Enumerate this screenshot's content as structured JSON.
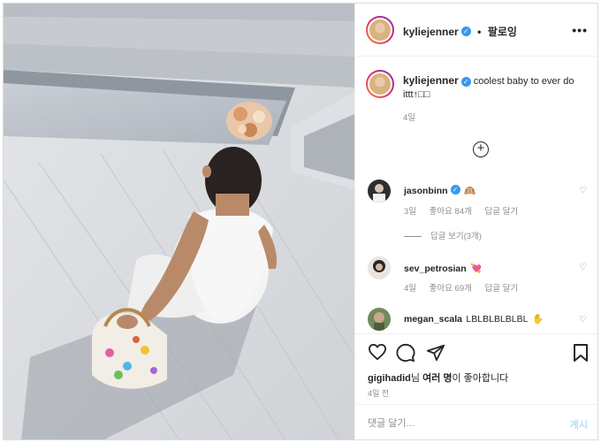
{
  "header": {
    "username": "kyliejenner",
    "separator": "•",
    "follow_label": "팔로잉",
    "more_label": "•••"
  },
  "caption": {
    "username": "kyliejenner",
    "text": "coolest baby to ever do ittt",
    "emoji": "↑□□",
    "age": "4일"
  },
  "comments": [
    {
      "username": "jasonbinn",
      "text": "",
      "emoji": "🙉",
      "age": "3일",
      "likes": "좋아요 84개",
      "reply": "답글 달기",
      "view_replies": "답글 보기(3개)"
    },
    {
      "username": "sev_petrosian",
      "text": "",
      "emoji": "💘",
      "age": "4일",
      "likes": "좋아요 69개",
      "reply": "답글 달기"
    },
    {
      "username": "megan_scala",
      "text": "LBLBLBLBLBL",
      "emoji": "✋"
    }
  ],
  "liked_by": {
    "user": "gigihadid",
    "particle": "님",
    "others": "여러 명",
    "suffix": "이 좋아합니다"
  },
  "timestamp": "4일 전",
  "comment_box": {
    "placeholder": "댓글 달기...",
    "post_label": "게시"
  },
  "icons": {
    "heart": "heart-icon",
    "comment": "comment-icon",
    "share": "share-icon",
    "save": "bookmark-icon"
  },
  "colors": {
    "verified": "#3897f0",
    "post_button_disabled": "#b2dffc",
    "meta_text": "#8e8e8e"
  }
}
